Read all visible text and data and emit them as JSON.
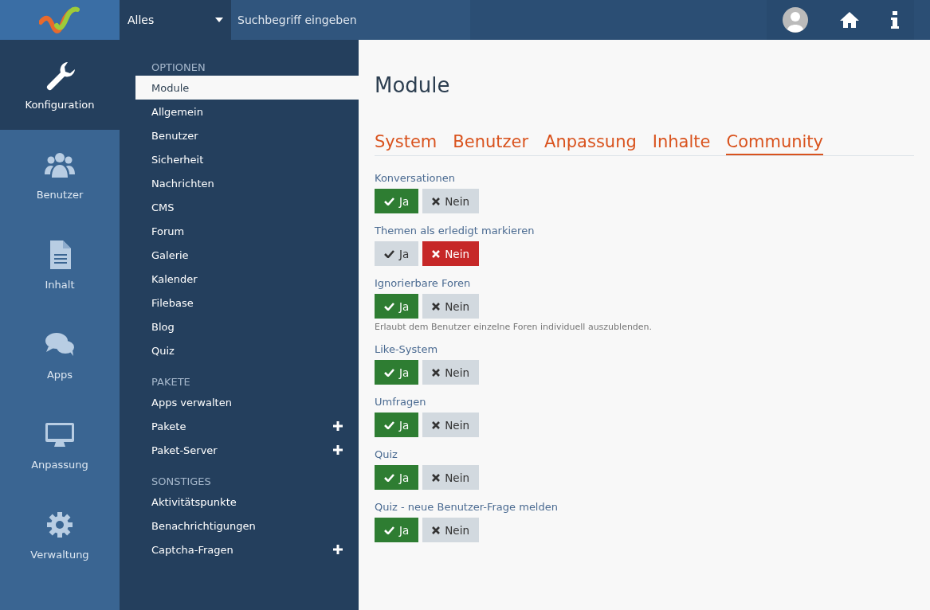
{
  "top_bar": {
    "search_scope": "Alles",
    "search": {
      "placeholder": "Suchbegriff eingeben"
    }
  },
  "main_menu": [
    {
      "label": "Konfiguration",
      "kind": "wrench",
      "selected": true
    },
    {
      "label": "Benutzer",
      "kind": "users",
      "selected": false
    },
    {
      "label": "Inhalt",
      "kind": "document",
      "selected": false
    },
    {
      "label": "Apps",
      "kind": "chat",
      "selected": false
    },
    {
      "label": "Anpassung",
      "kind": "monitor",
      "selected": false
    },
    {
      "label": "Verwaltung",
      "kind": "gear",
      "selected": false
    }
  ],
  "sub_menu": [
    {
      "title": "OPTIONEN",
      "items": [
        {
          "label": "Module",
          "selected": true,
          "expandable": false
        },
        {
          "label": "Allgemein",
          "selected": false,
          "expandable": false
        },
        {
          "label": "Benutzer",
          "selected": false,
          "expandable": false
        },
        {
          "label": "Sicherheit",
          "selected": false,
          "expandable": false
        },
        {
          "label": "Nachrichten",
          "selected": false,
          "expandable": false
        },
        {
          "label": "CMS",
          "selected": false,
          "expandable": false
        },
        {
          "label": "Forum",
          "selected": false,
          "expandable": false
        },
        {
          "label": "Galerie",
          "selected": false,
          "expandable": false
        },
        {
          "label": "Kalender",
          "selected": false,
          "expandable": false
        },
        {
          "label": "Filebase",
          "selected": false,
          "expandable": false
        },
        {
          "label": "Blog",
          "selected": false,
          "expandable": false
        },
        {
          "label": "Quiz",
          "selected": false,
          "expandable": false
        }
      ]
    },
    {
      "title": "PAKETE",
      "items": [
        {
          "label": "Apps verwalten",
          "selected": false,
          "expandable": false
        },
        {
          "label": "Pakete",
          "selected": false,
          "expandable": true
        },
        {
          "label": "Paket-Server",
          "selected": false,
          "expandable": true
        }
      ]
    },
    {
      "title": "SONSTIGES",
      "items": [
        {
          "label": "Aktivitätspunkte",
          "selected": false,
          "expandable": false
        },
        {
          "label": "Benachrichtigungen",
          "selected": false,
          "expandable": false
        },
        {
          "label": "Captcha-Fragen",
          "selected": false,
          "expandable": true
        }
      ]
    }
  ],
  "content": {
    "title": "Module",
    "tabs": [
      {
        "label": "System",
        "selected": false
      },
      {
        "label": "Benutzer",
        "selected": false
      },
      {
        "label": "Anpassung",
        "selected": false
      },
      {
        "label": "Inhalte",
        "selected": false
      },
      {
        "label": "Community",
        "selected": true
      }
    ],
    "options": [
      {
        "label": "Konversationen",
        "choices": [
          {
            "kind": "yes",
            "label": "Ja",
            "selected": true
          },
          {
            "kind": "no",
            "label": "Nein",
            "selected": false
          }
        ]
      },
      {
        "label": "Themen als erledigt markieren",
        "choices": [
          {
            "kind": "yes",
            "label": "Ja",
            "selected": false
          },
          {
            "kind": "no",
            "label": "Nein",
            "selected": true
          }
        ]
      },
      {
        "label": "Ignorierbare Foren",
        "description": "Erlaubt dem Benutzer einzelne Foren individuell auszublenden.",
        "choices": [
          {
            "kind": "yes",
            "label": "Ja",
            "selected": true
          },
          {
            "kind": "no",
            "label": "Nein",
            "selected": false
          }
        ]
      },
      {
        "label": "Like-System",
        "choices": [
          {
            "kind": "yes",
            "label": "Ja",
            "selected": true
          },
          {
            "kind": "no",
            "label": "Nein",
            "selected": false
          }
        ]
      },
      {
        "label": "Umfragen",
        "choices": [
          {
            "kind": "yes",
            "label": "Ja",
            "selected": true
          },
          {
            "kind": "no",
            "label": "Nein",
            "selected": false
          }
        ]
      },
      {
        "label": "Quiz",
        "choices": [
          {
            "kind": "yes",
            "label": "Ja",
            "selected": true
          },
          {
            "kind": "no",
            "label": "Nein",
            "selected": false
          }
        ]
      },
      {
        "label": "Quiz - neue Benutzer-Frage melden",
        "choices": [
          {
            "kind": "yes",
            "label": "Ja",
            "selected": true
          },
          {
            "kind": "no",
            "label": "Nein",
            "selected": false
          }
        ]
      }
    ]
  }
}
